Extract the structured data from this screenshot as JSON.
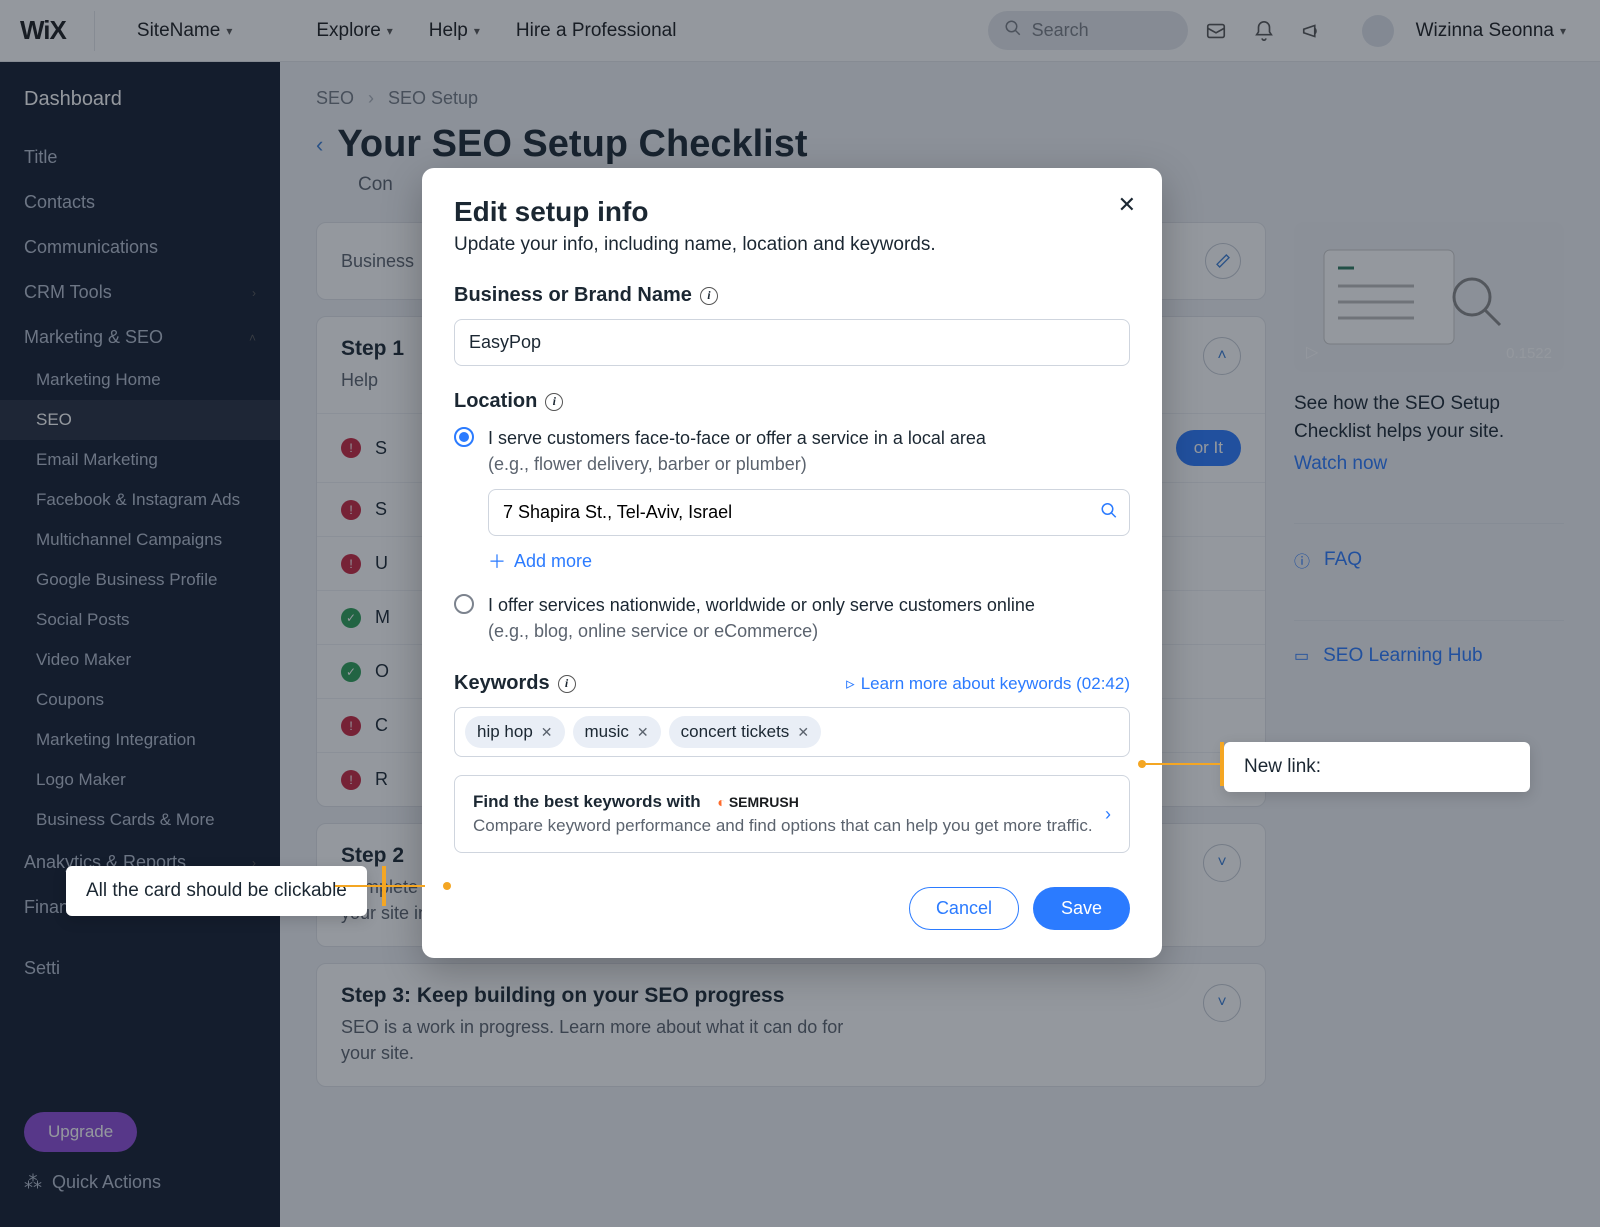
{
  "topbar": {
    "logo": "WiX",
    "site": "SiteName",
    "explore": "Explore",
    "help": "Help",
    "hire": "Hire a Professional",
    "search_ph": "Search",
    "user": "Wizinna Seonna"
  },
  "sidebar": {
    "dashboard": "Dashboard",
    "title": "Title",
    "contacts": "Contacts",
    "communications": "Communications",
    "crm": "CRM Tools",
    "mkt": "Marketing & SEO",
    "subs": {
      "home": "Marketing Home",
      "seo": "SEO",
      "email": "Email Marketing",
      "fb": "Facebook & Instagram Ads",
      "multi": "Multichannel Campaigns",
      "gbp": "Google Business Profile",
      "social": "Social Posts",
      "video": "Video Maker",
      "coupons": "Coupons",
      "integ": "Marketing Integration",
      "logo": "Logo Maker",
      "bc": "Business Cards & More"
    },
    "analytics": "Anakytics & Reports",
    "finances": "Finances",
    "settings": "Setti",
    "upgrade": "Upgrade",
    "quick": "Quick Actions"
  },
  "page": {
    "crumb1": "SEO",
    "crumb2": "SEO Setup",
    "title": "Your SEO Setup Checklist",
    "sub": "Con",
    "biz_label": "Business",
    "step1_title": "Step 1",
    "step1_sub": "Help",
    "tasks": {
      "t1": "S",
      "t2": "S",
      "t3": "U",
      "t4": "M",
      "t5": "O",
      "t6": "C",
      "t7": "R"
    },
    "go_btn": "or It",
    "step2_title": "Step 2",
    "step2_sub": "Complete these essential tasks to make it easier for people to find your site in search results",
    "step3_title": "Step 3: Keep building on your SEO progress",
    "step3_sub": "SEO is a work in progress. Learn more about what it can do for your site."
  },
  "right": {
    "duration": "0.1522",
    "text": "See how the SEO Setup Checklist helps your site.",
    "watch": "Watch now",
    "faq": "FAQ",
    "hub": "SEO Learning Hub"
  },
  "modal": {
    "title": "Edit setup info",
    "sub": "Update your info, including name, location and keywords.",
    "brand_lbl": "Business or Brand Name",
    "brand_val": "EasyPop",
    "loc_lbl": "Location",
    "radio1": "I serve customers face-to-face or offer a service in a local area",
    "radio1_sub": "(e.g., flower delivery, barber or plumber)",
    "address": "7 Shapira St., Tel-Aviv, Israel",
    "add_more": "Add more",
    "radio2": "I offer services nationwide, worldwide or only serve customers online",
    "radio2_sub": "(e.g., blog, online service or eCommerce)",
    "kw_lbl": "Keywords",
    "learn": "Learn more about keywords (02:42)",
    "tags": {
      "t1": "hip hop",
      "t2": "music",
      "t3": "concert tickets"
    },
    "sr_title": "Find the best keywords with",
    "sr_brand": "SEMRUSH",
    "sr_sub": "Compare keyword performance and find options that can help you get more traffic.",
    "cancel": "Cancel",
    "save": "Save"
  },
  "annot": {
    "left": "All the card should be clickable",
    "right": "New link:"
  },
  "colors": {
    "accent": "#2b7bff",
    "annotation": "#f4a623"
  }
}
